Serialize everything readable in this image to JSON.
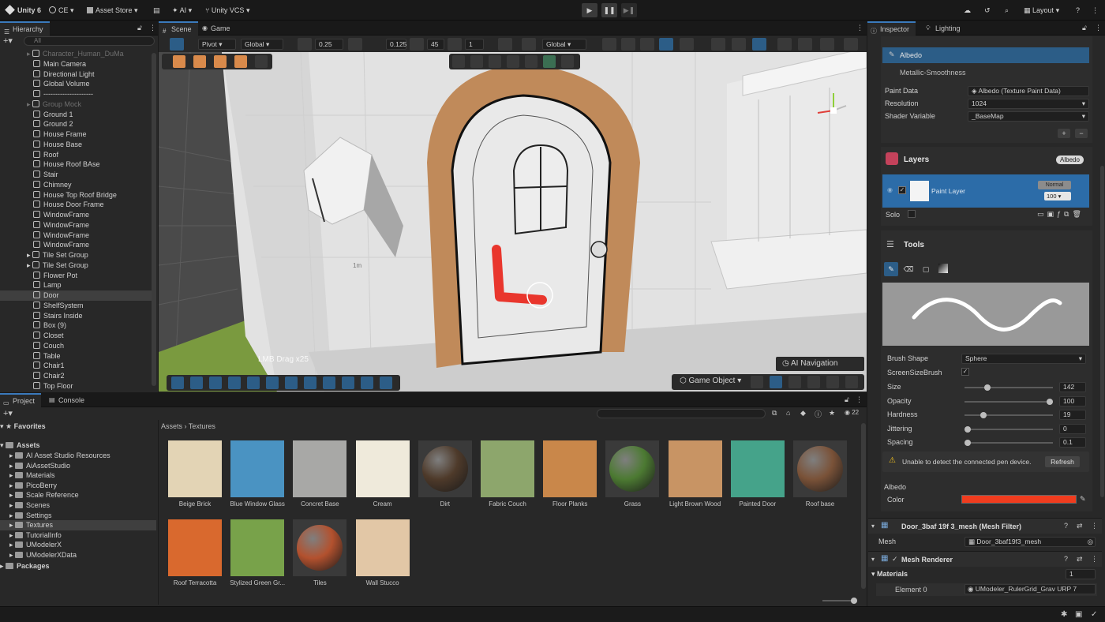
{
  "topbar": {
    "app_label": "Unity 6",
    "account_label": "CE",
    "asset_store_label": "Asset Store",
    "ai_label": "AI",
    "vcs_label": "Unity VCS",
    "layout_label": "Layout"
  },
  "hierarchy": {
    "tab_label": "Hierarchy",
    "search_placeholder": "All",
    "items": [
      {
        "label": "Character_Human_DuMa",
        "dim": true
      },
      {
        "label": "Main Camera",
        "dim": false
      },
      {
        "label": "Directional Light",
        "dim": false
      },
      {
        "label": "Global Volume",
        "dim": false
      },
      {
        "label": "---------------------",
        "dim": false
      },
      {
        "label": "Group Mock",
        "dim": true
      },
      {
        "label": "Ground 1",
        "dim": false
      },
      {
        "label": "Ground 2",
        "dim": false
      },
      {
        "label": "House Frame",
        "dim": false
      },
      {
        "label": "House Base",
        "dim": false
      },
      {
        "label": "Roof",
        "dim": false
      },
      {
        "label": "House Roof BAse",
        "dim": false
      },
      {
        "label": "Stair",
        "dim": false
      },
      {
        "label": "Chimney",
        "dim": false
      },
      {
        "label": "House Top Roof Bridge",
        "dim": false
      },
      {
        "label": "House Door Frame",
        "dim": false
      },
      {
        "label": "WindowFrame",
        "dim": false
      },
      {
        "label": "WindowFrame",
        "dim": false
      },
      {
        "label": "WindowFrame",
        "dim": false
      },
      {
        "label": "WindowFrame",
        "dim": false
      },
      {
        "label": "Tile Set Group",
        "dim": false
      },
      {
        "label": "Tile Set Group",
        "dim": false
      },
      {
        "label": "Flower Pot",
        "dim": false
      },
      {
        "label": "Lamp",
        "dim": false
      },
      {
        "label": "Door",
        "dim": false
      },
      {
        "label": "ShelfSystem",
        "dim": false
      },
      {
        "label": "Stairs Inside",
        "dim": false
      },
      {
        "label": "Box (9)",
        "dim": false
      },
      {
        "label": "Closet",
        "dim": false
      },
      {
        "label": "Couch",
        "dim": false
      },
      {
        "label": "Table",
        "dim": false
      },
      {
        "label": "Chair1",
        "dim": false
      },
      {
        "label": "Chair2",
        "dim": false
      },
      {
        "label": "Top Floor",
        "dim": false
      }
    ]
  },
  "scene": {
    "tab_scene": "Scene",
    "tab_game": "Game",
    "pivot_label": "Pivot",
    "global_label": "Global",
    "snap_value": "0.25",
    "snap_value2": "0.125",
    "angle_value": "45",
    "scale_value": "1",
    "global_label2": "Global",
    "brush_hint": "LMB Drag x25",
    "ai_nav_label": "AI Navigation",
    "game_object_label": "Game Object",
    "grid_label": "1m"
  },
  "project": {
    "tab_project": "Project",
    "tab_console": "Console",
    "favorites_label": "Favorites",
    "assets_label": "Assets",
    "packages_label": "Packages",
    "folders": [
      "AI Asset Studio Resources",
      "AiAssetStudio",
      "Materials",
      "PicoBerry",
      "Scale Reference",
      "Scenes",
      "Settings",
      "Textures",
      "TutorialInfo",
      "UModelerX",
      "UModelerXData"
    ],
    "breadcrumb_root": "Assets",
    "breadcrumb_current": "Textures",
    "count_badge": "22",
    "textures": [
      {
        "label": "Beige Brick",
        "color": "#e3d4b5",
        "sphere": false
      },
      {
        "label": "Blue Window Glass",
        "color": "#4a93c2",
        "sphere": false
      },
      {
        "label": "Concret Base",
        "color": "#a8a8a6",
        "sphere": false
      },
      {
        "label": "Cream",
        "color": "#efeadb",
        "sphere": false
      },
      {
        "label": "Dirt",
        "color": "#4e3a2a",
        "sphere": true
      },
      {
        "label": "Fabric Couch",
        "color": "#8da66c",
        "sphere": false
      },
      {
        "label": "Floor Planks",
        "color": "#c9874a",
        "sphere": false
      },
      {
        "label": "Grass",
        "color": "#4c7a32",
        "sphere": true
      },
      {
        "label": "Light Brown Wood",
        "color": "#c89464",
        "sphere": false
      },
      {
        "label": "Painted Door",
        "color": "#45a38a",
        "sphere": false
      },
      {
        "label": "Roof base",
        "color": "#7a5238",
        "sphere": true
      },
      {
        "label": "Roof Terracotta",
        "color": "#d9692e",
        "sphere": false
      },
      {
        "label": "Stylized Green Gr...",
        "color": "#78a24a",
        "sphere": false
      },
      {
        "label": "Tiles",
        "color": "#b3512e",
        "sphere": true
      },
      {
        "label": "Wall Stucco",
        "color": "#e2c7a6",
        "sphere": false
      }
    ]
  },
  "inspector": {
    "tab_inspector": "Inspector",
    "tab_lighting": "Lighting",
    "channel_albedo": "Albedo",
    "channel_metallic": "Metallic-Smoothness",
    "paint_data_label": "Paint Data",
    "paint_data_value": "Albedo (Texture Paint Data)",
    "resolution_label": "Resolution",
    "resolution_value": "1024",
    "shader_var_label": "Shader Variable",
    "shader_var_value": "_BaseMap",
    "layers_title": "Layers",
    "layers_badge": "Albedo",
    "layer_name": "Paint Layer",
    "blend_mode": "Normal",
    "layer_opacity": "100",
    "solo_label": "Solo",
    "tools_title": "Tools",
    "brush_shape_label": "Brush Shape",
    "brush_shape_value": "Sphere",
    "screen_size_label": "ScreenSizeBrush",
    "size_label": "Size",
    "size_value": "142",
    "opacity_label": "Opacity",
    "opacity_value": "100",
    "hardness_label": "Hardness",
    "hardness_value": "19",
    "jittering_label": "Jittering",
    "jittering_value": "0",
    "spacing_label": "Spacing",
    "spacing_value": "0.1",
    "size_level": 0.24,
    "opacity_level": 1.0,
    "hardness_level": 0.19,
    "jittering_level": 0.0,
    "spacing_level": 0.0,
    "warning_text": "Unable to detect the connected pen device.",
    "refresh_label": "Refresh",
    "albedo_section": "Albedo",
    "color_label": "Color",
    "brush_color": "#f03c1e",
    "mesh_filter_title": "Door_3baf 19f 3_mesh (Mesh Filter)",
    "mesh_label": "Mesh",
    "mesh_value": "Door_3baf19f3_mesh",
    "mesh_renderer_title": "Mesh Renderer",
    "materials_label": "Materials",
    "materials_count": "1",
    "element0_label": "Element 0",
    "element0_value": "UModeler_RulerGrid_Grav URP 7"
  },
  "colors": {
    "accent": "#3a79bb",
    "selection": "#2c5d87",
    "paint_red": "#e8261c",
    "door_frame": "#c08a5a"
  }
}
